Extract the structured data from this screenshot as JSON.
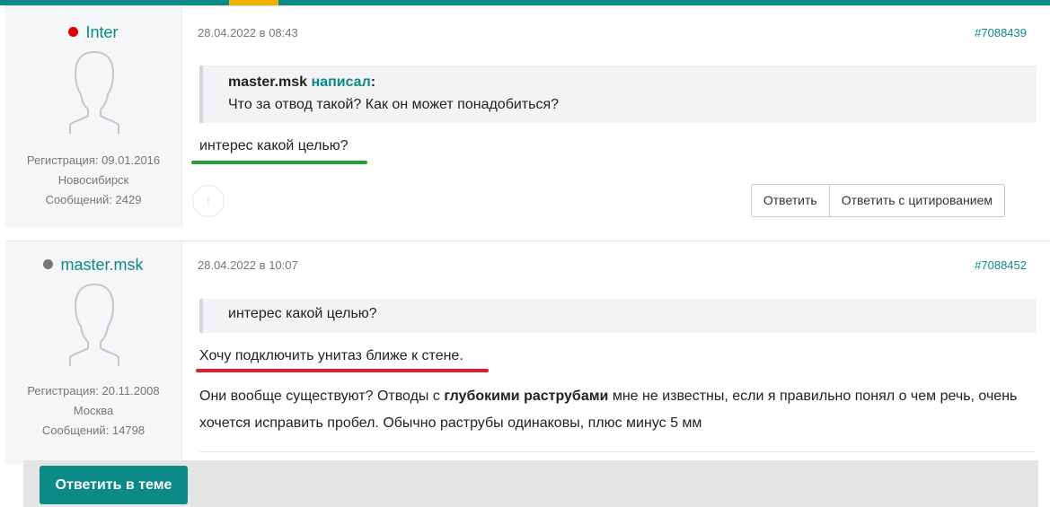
{
  "posts": [
    {
      "author": "Inter",
      "status": "online",
      "reg": "Регистрация: 09.01.2016",
      "city": "Новосибирск",
      "msgs": "Сообщений: 2429",
      "date": "28.04.2022 в 08:43",
      "id": "#7088439",
      "quote_author": "master.msk",
      "quote_wrote": "написал",
      "quote_colon": ":",
      "quote_text": "Что за отвод такой? Как он может понадобиться?",
      "text": "интерес какой целью?",
      "react_icon": "!",
      "reply_label": "Ответить",
      "reply_quote_label": "Ответить с цитированием"
    },
    {
      "author": "master.msk",
      "status": "offline",
      "reg": "Регистрация: 20.11.2008",
      "city": "Москва",
      "msgs": "Сообщений: 14798",
      "date": "28.04.2022 в 10:07",
      "id": "#7088452",
      "quote_text": "интерес какой целью?",
      "text": "Хочу подключить унитаз ближе к стене.",
      "text2_a": "Они вообще существуют? Отводы с ",
      "text2_b": "глубокими раструбами",
      "text2_c": " мне не известны, если я правильно понял о чем речь, очень хочется исправить пробел. Обычно раструбы одинаковы, плюс минус 5 мм"
    }
  ],
  "reply_thread_label": "Ответить в теме",
  "colors": {
    "accent": "#0c8a87",
    "highlight_green": "#23a03a",
    "highlight_red": "#dc1f2b",
    "online": "#e00000"
  }
}
